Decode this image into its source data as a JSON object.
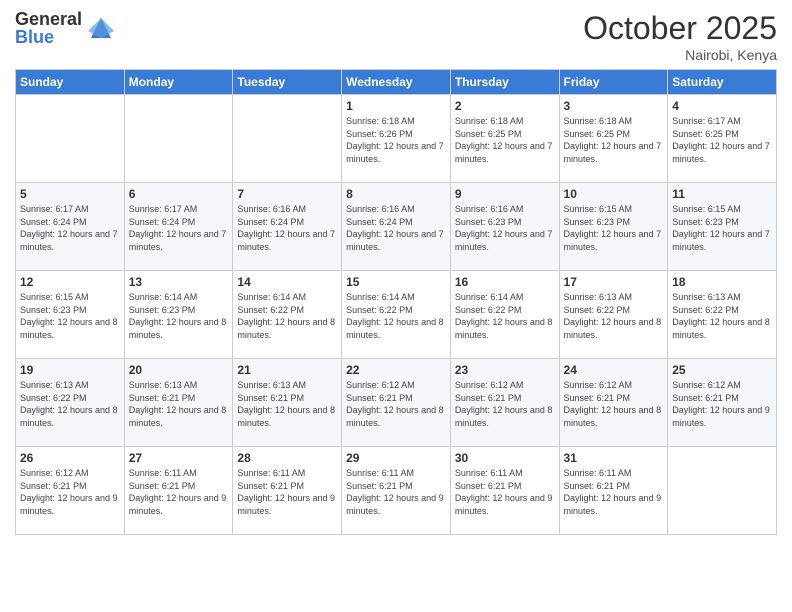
{
  "logo": {
    "general": "General",
    "blue": "Blue"
  },
  "title": "October 2025",
  "location": "Nairobi, Kenya",
  "headers": [
    "Sunday",
    "Monday",
    "Tuesday",
    "Wednesday",
    "Thursday",
    "Friday",
    "Saturday"
  ],
  "weeks": [
    [
      {
        "day": "",
        "info": ""
      },
      {
        "day": "",
        "info": ""
      },
      {
        "day": "",
        "info": ""
      },
      {
        "day": "1",
        "info": "Sunrise: 6:18 AM\nSunset: 6:26 PM\nDaylight: 12 hours and 7 minutes."
      },
      {
        "day": "2",
        "info": "Sunrise: 6:18 AM\nSunset: 6:25 PM\nDaylight: 12 hours and 7 minutes."
      },
      {
        "day": "3",
        "info": "Sunrise: 6:18 AM\nSunset: 6:25 PM\nDaylight: 12 hours and 7 minutes."
      },
      {
        "day": "4",
        "info": "Sunrise: 6:17 AM\nSunset: 6:25 PM\nDaylight: 12 hours and 7 minutes."
      }
    ],
    [
      {
        "day": "5",
        "info": "Sunrise: 6:17 AM\nSunset: 6:24 PM\nDaylight: 12 hours and 7 minutes."
      },
      {
        "day": "6",
        "info": "Sunrise: 6:17 AM\nSunset: 6:24 PM\nDaylight: 12 hours and 7 minutes."
      },
      {
        "day": "7",
        "info": "Sunrise: 6:16 AM\nSunset: 6:24 PM\nDaylight: 12 hours and 7 minutes."
      },
      {
        "day": "8",
        "info": "Sunrise: 6:16 AM\nSunset: 6:24 PM\nDaylight: 12 hours and 7 minutes."
      },
      {
        "day": "9",
        "info": "Sunrise: 6:16 AM\nSunset: 6:23 PM\nDaylight: 12 hours and 7 minutes."
      },
      {
        "day": "10",
        "info": "Sunrise: 6:15 AM\nSunset: 6:23 PM\nDaylight: 12 hours and 7 minutes."
      },
      {
        "day": "11",
        "info": "Sunrise: 6:15 AM\nSunset: 6:23 PM\nDaylight: 12 hours and 7 minutes."
      }
    ],
    [
      {
        "day": "12",
        "info": "Sunrise: 6:15 AM\nSunset: 6:23 PM\nDaylight: 12 hours and 8 minutes."
      },
      {
        "day": "13",
        "info": "Sunrise: 6:14 AM\nSunset: 6:23 PM\nDaylight: 12 hours and 8 minutes."
      },
      {
        "day": "14",
        "info": "Sunrise: 6:14 AM\nSunset: 6:22 PM\nDaylight: 12 hours and 8 minutes."
      },
      {
        "day": "15",
        "info": "Sunrise: 6:14 AM\nSunset: 6:22 PM\nDaylight: 12 hours and 8 minutes."
      },
      {
        "day": "16",
        "info": "Sunrise: 6:14 AM\nSunset: 6:22 PM\nDaylight: 12 hours and 8 minutes."
      },
      {
        "day": "17",
        "info": "Sunrise: 6:13 AM\nSunset: 6:22 PM\nDaylight: 12 hours and 8 minutes."
      },
      {
        "day": "18",
        "info": "Sunrise: 6:13 AM\nSunset: 6:22 PM\nDaylight: 12 hours and 8 minutes."
      }
    ],
    [
      {
        "day": "19",
        "info": "Sunrise: 6:13 AM\nSunset: 6:22 PM\nDaylight: 12 hours and 8 minutes."
      },
      {
        "day": "20",
        "info": "Sunrise: 6:13 AM\nSunset: 6:21 PM\nDaylight: 12 hours and 8 minutes."
      },
      {
        "day": "21",
        "info": "Sunrise: 6:13 AM\nSunset: 6:21 PM\nDaylight: 12 hours and 8 minutes."
      },
      {
        "day": "22",
        "info": "Sunrise: 6:12 AM\nSunset: 6:21 PM\nDaylight: 12 hours and 8 minutes."
      },
      {
        "day": "23",
        "info": "Sunrise: 6:12 AM\nSunset: 6:21 PM\nDaylight: 12 hours and 8 minutes."
      },
      {
        "day": "24",
        "info": "Sunrise: 6:12 AM\nSunset: 6:21 PM\nDaylight: 12 hours and 8 minutes."
      },
      {
        "day": "25",
        "info": "Sunrise: 6:12 AM\nSunset: 6:21 PM\nDaylight: 12 hours and 9 minutes."
      }
    ],
    [
      {
        "day": "26",
        "info": "Sunrise: 6:12 AM\nSunset: 6:21 PM\nDaylight: 12 hours and 9 minutes."
      },
      {
        "day": "27",
        "info": "Sunrise: 6:11 AM\nSunset: 6:21 PM\nDaylight: 12 hours and 9 minutes."
      },
      {
        "day": "28",
        "info": "Sunrise: 6:11 AM\nSunset: 6:21 PM\nDaylight: 12 hours and 9 minutes."
      },
      {
        "day": "29",
        "info": "Sunrise: 6:11 AM\nSunset: 6:21 PM\nDaylight: 12 hours and 9 minutes."
      },
      {
        "day": "30",
        "info": "Sunrise: 6:11 AM\nSunset: 6:21 PM\nDaylight: 12 hours and 9 minutes."
      },
      {
        "day": "31",
        "info": "Sunrise: 6:11 AM\nSunset: 6:21 PM\nDaylight: 12 hours and 9 minutes."
      },
      {
        "day": "",
        "info": ""
      }
    ]
  ]
}
